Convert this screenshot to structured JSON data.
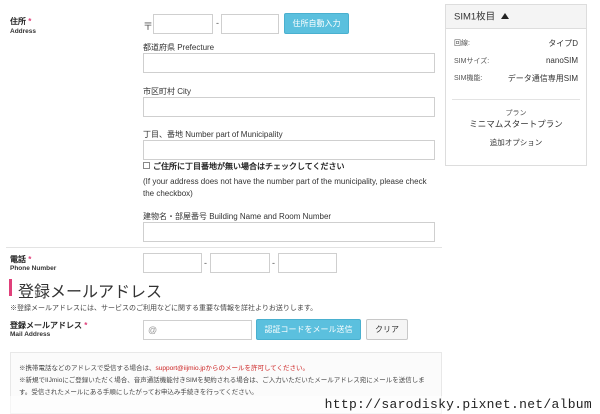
{
  "address": {
    "label": "住所",
    "required_mark": "*",
    "sub_label": "Address",
    "postal_prefix": "〒",
    "postal_dash": "-",
    "auto_fill_button": "住所自動入力",
    "prefecture_label": "都道府県 Prefecture",
    "city_label": "市区町村 City",
    "number_label": "丁目、番地 Number part of Municipality",
    "checkbox_label": "ご住所に丁目番地が無い場合はチェックしてください",
    "checkbox_note": "(If your address does not have the number part of the municipality, please check the checkbox)",
    "building_label": "建物名・部屋番号 Building Name and Room Number"
  },
  "phone": {
    "label": "電話",
    "required_mark": "*",
    "sub_label": "Phone Number",
    "dash": "-"
  },
  "email_section": {
    "heading": "登録メールアドレス",
    "description": "※登録メールアドレスには、サービスのご利用などに関する重要な情報を詳社よりお送りします。",
    "field_label": "登録メールアドレス",
    "required_mark": "*",
    "field_sub_label": "Mail Address",
    "placeholder": "@",
    "send_code_button": "認証コードをメール送信",
    "clear_button": "クリア",
    "notice_line1_prefix": "※携帯電話などのアドレスで受信する場合は、",
    "notice_line1_highlight": "support@iijmio.jpからのメールを許可してください。",
    "notice_line2": "※新規でIIJmioにご登録いただく場合、音声通話機能付きSIMを契約される場合は、ご入力いただいたメールアドレス宛にメールを送信します。受信されたメールにある手順にしたがってお申込み手続きを行ってください。"
  },
  "sidebar": {
    "title": "SIM1枚目",
    "toggle_icon": "chevron-up-icon",
    "rows": [
      {
        "key": "回線:",
        "value": "タイプD"
      },
      {
        "key": "SIMサイズ:",
        "value": "nanoSIM"
      },
      {
        "key": "SIM機能:",
        "value": "データ通信専用SIM"
      }
    ],
    "plan_label": "プラン",
    "plan_value": "ミニマムスタートプラン",
    "option_label": "追加オプション"
  },
  "watermark": "http://sarodisky.pixnet.net/album",
  "colors": {
    "accent_blue": "#5bc0de",
    "required_pink": "#e0407a",
    "heading_bar": "#e0407a",
    "notice_red": "#cc2222"
  }
}
